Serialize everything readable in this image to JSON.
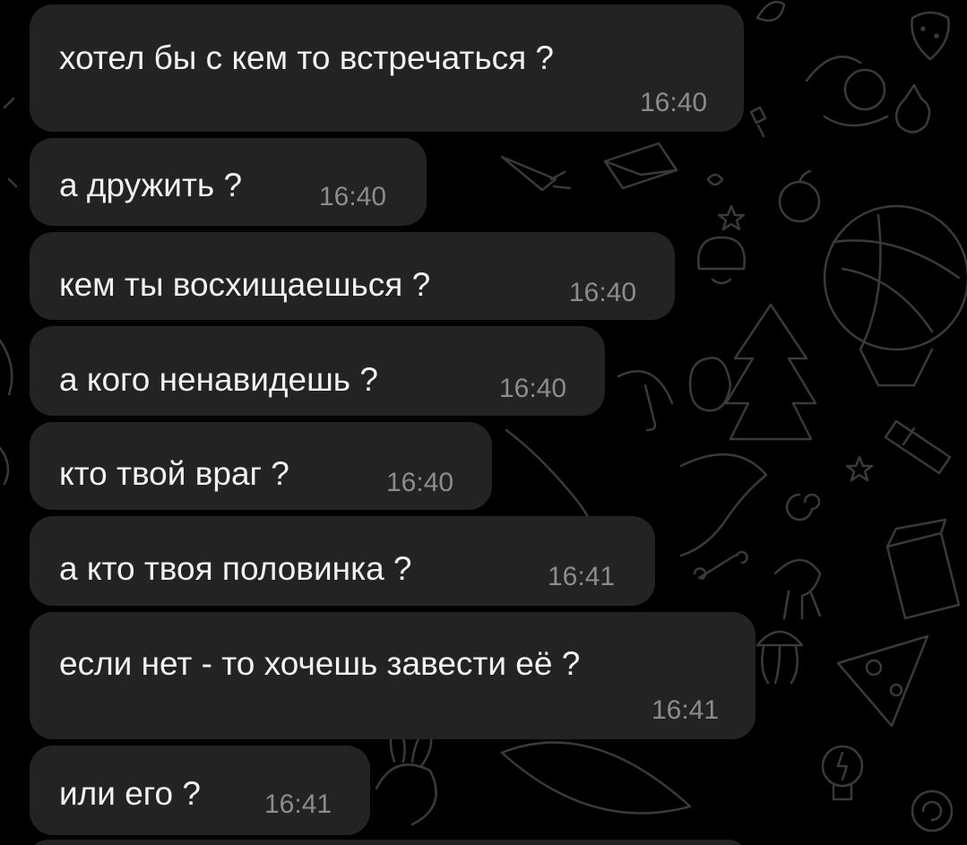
{
  "messages": [
    {
      "text": "хотел бы с кем  то встречаться ?",
      "time": "16:40"
    },
    {
      "text": "а дружить ?",
      "time": "16:40"
    },
    {
      "text": "кем ты восхищаешься ?",
      "time": "16:40"
    },
    {
      "text": "а кого ненавидешь ?",
      "time": "16:40"
    },
    {
      "text": "кто твой враг ?",
      "time": "16:40"
    },
    {
      "text": "а кто твоя половинка ?",
      "time": "16:41"
    },
    {
      "text": "если нет - то хочешь завести её ?",
      "time": "16:41"
    },
    {
      "text": "или его ?",
      "time": "16:41"
    }
  ],
  "colors": {
    "background": "#000000",
    "bubble": "#232323",
    "text": "#f2f2f2",
    "time": "#8c8c8c"
  }
}
